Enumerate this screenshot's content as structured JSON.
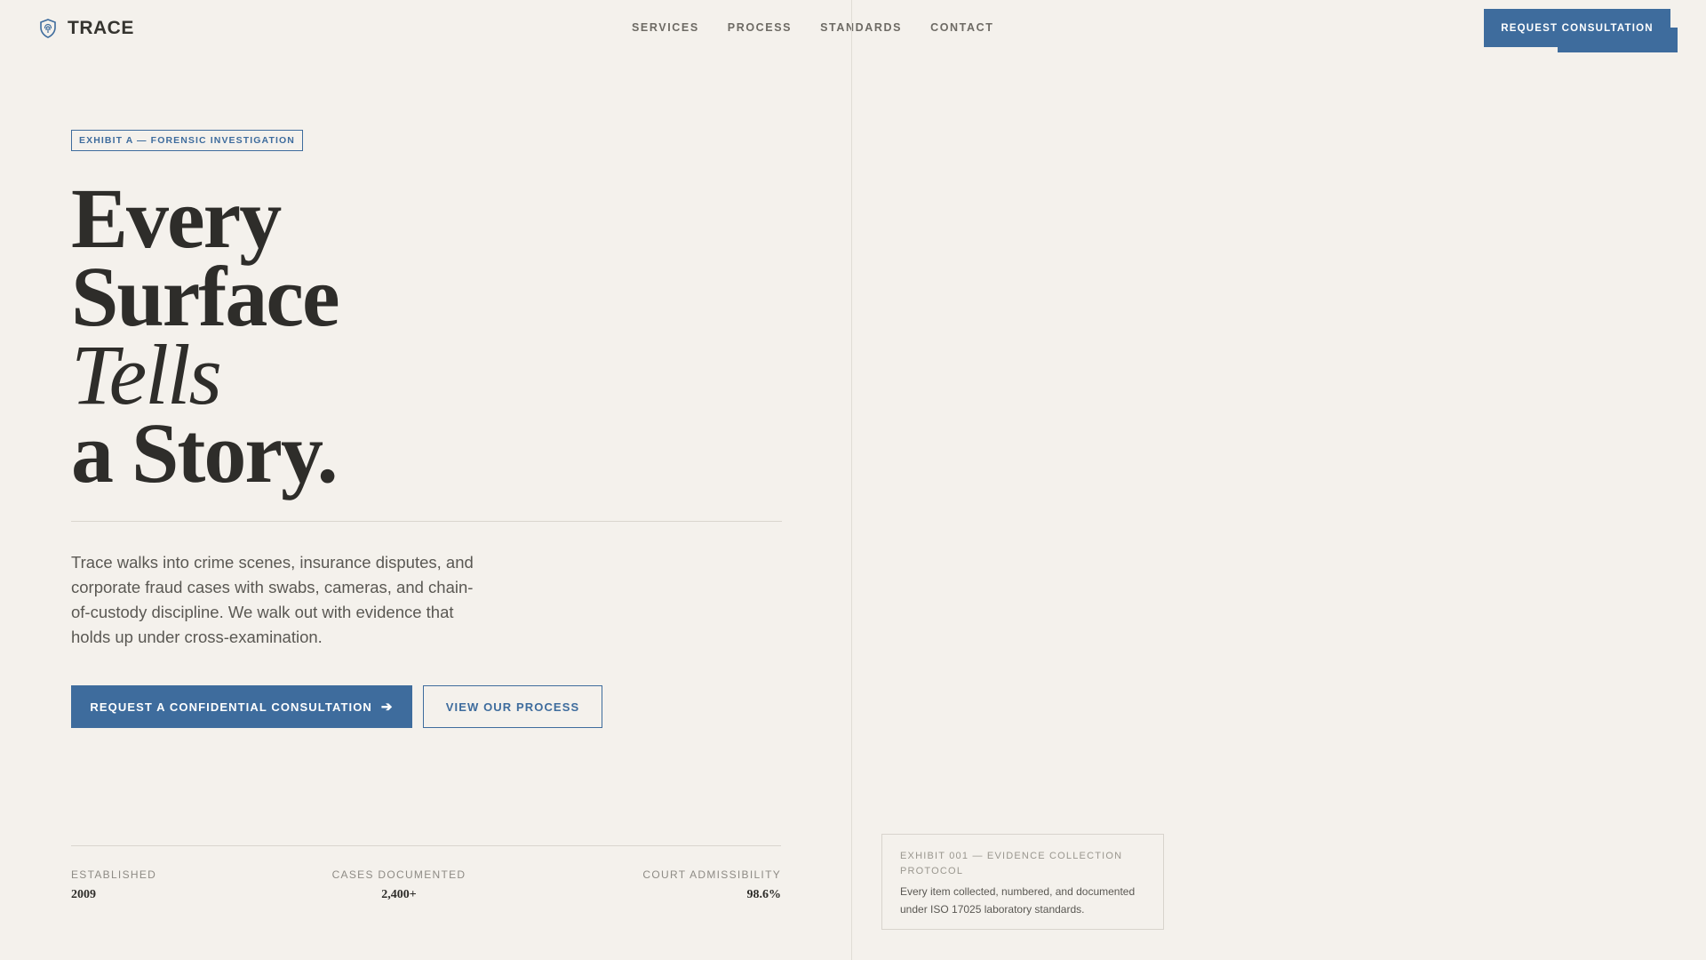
{
  "header": {
    "brand_name": "TRACE",
    "brand_icon": "fingerprint-shield-icon",
    "nav": [
      "SERVICES",
      "PROCESS",
      "STANDARDS",
      "CONTACT"
    ],
    "cta_label": "REQUEST CONSULTATION"
  },
  "hero": {
    "tag": "EXHIBIT A — FORENSIC INVESTIGATION",
    "headline_lines": [
      "Every",
      "Surface",
      "Tells",
      "a Story."
    ],
    "intro": "Trace walks into crime scenes, insurance disputes, and corporate fraud cases with swabs, cameras, and chain-of-custody discipline. We walk out with evidence that holds up under cross-examination.",
    "primary_label": "REQUEST A CONFIDENTIAL CONSULTATION",
    "primary_icon": "arrow-right-icon",
    "secondary_label": "VIEW OUR PROCESS"
  },
  "stats": [
    {
      "label": "ESTABLISHED",
      "value": "2009"
    },
    {
      "label": "CASES DOCUMENTED",
      "value": "2,400+"
    },
    {
      "label": "COURT ADMISSIBILITY",
      "value": "98.6%"
    }
  ],
  "exhibit_card": {
    "title": "EXHIBIT 001 — EVIDENCE COLLECTION PROTOCOL",
    "body": "Every item collected, numbered, and documented under ISO 17025 laboratory standards."
  },
  "colors": {
    "accent": "#3e6c9d",
    "background": "#f4f1ec",
    "text": "#2e2d2a"
  }
}
